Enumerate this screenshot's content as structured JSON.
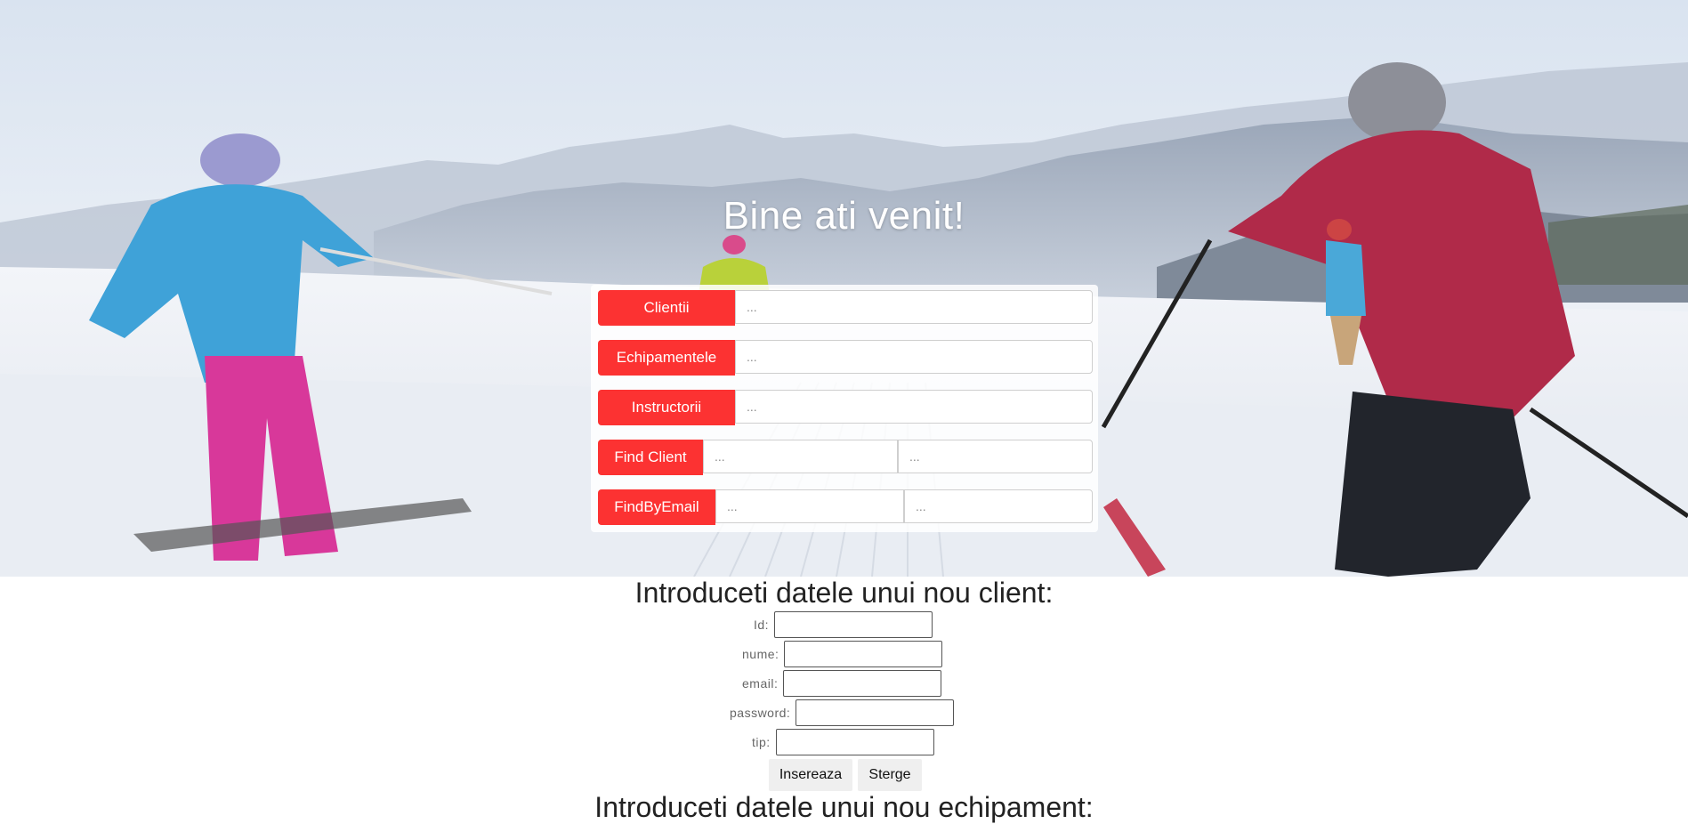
{
  "hero": {
    "title": "Bine ati venit!"
  },
  "actions": {
    "clients_label": "Clientii",
    "equipment_label": "Echipamentele",
    "instructors_label": "Instructorii",
    "find_client_label": "Find Client",
    "find_by_email_label": "FindByEmail",
    "placeholder": "..."
  },
  "client_form": {
    "title": "Introduceti datele unui nou client:",
    "id_label": "Id:",
    "nume_label": "nume:",
    "email_label": "email:",
    "password_label": "password:",
    "tip_label": "tip:",
    "insert_label": "Insereaza",
    "delete_label": "Sterge"
  },
  "equipment_form": {
    "title": "Introduceti datele unui nou echipament:"
  },
  "colors": {
    "accent": "#fc3232",
    "sky": "#e8eef6",
    "snow": "#f4f6fa"
  }
}
